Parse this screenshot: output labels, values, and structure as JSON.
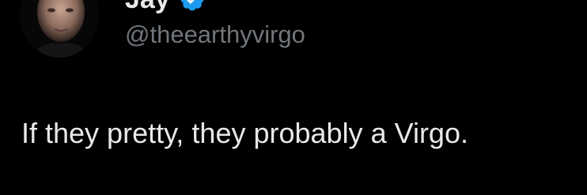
{
  "author": {
    "display_name": "Jay",
    "handle": "@theearthyvirgo",
    "verified_badge_icon": "verified-badge-icon",
    "verified_color": "#1d9bf0",
    "avatar_icon": "avatar-photo"
  },
  "tweet": {
    "text": "If they pretty, they probably a Virgo."
  },
  "colors": {
    "background": "#000000",
    "primary_text": "#e7e9ea",
    "secondary_text": "#71767b"
  }
}
